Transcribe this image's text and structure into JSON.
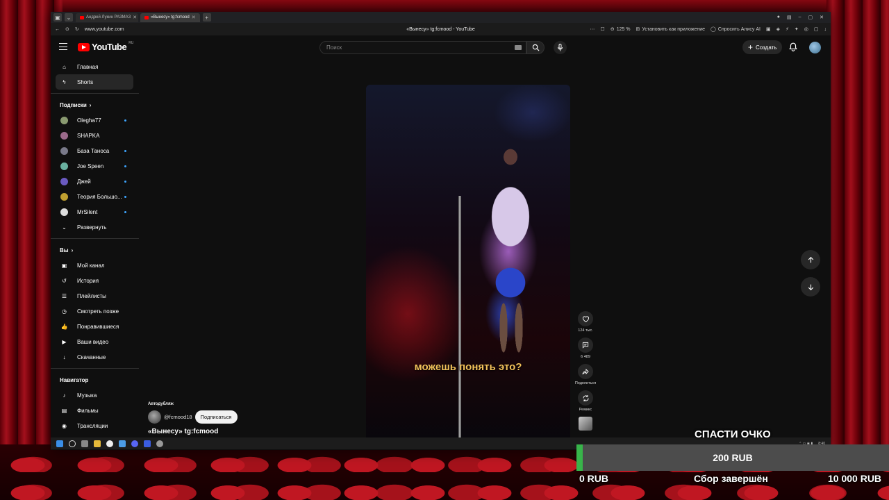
{
  "browser": {
    "tabs": [
      {
        "label": "Андрей Лукин РАЗМАЗ",
        "active": false
      },
      {
        "label": "«Вынесу» tg:fcmood",
        "active": true
      }
    ],
    "url": "www.youtube.com",
    "page_title": "«Вынесу» tg:fcmood - YouTube",
    "zoom": "125 %",
    "install_app": "Установить как приложение",
    "ask_alice": "Спросить Алису AI"
  },
  "header": {
    "logo_text": "YouTube",
    "logo_region": "RU",
    "search_placeholder": "Поиск",
    "create_label": "Создать"
  },
  "sidebar": {
    "main": [
      {
        "label": "Главная",
        "icon": "home-icon"
      },
      {
        "label": "Shorts",
        "icon": "shorts-icon",
        "active": true
      }
    ],
    "subscriptions_title": "Подписки",
    "subscriptions": [
      {
        "label": "Olegha77",
        "color": "#8a9a70",
        "dot": true
      },
      {
        "label": "SHAPKA",
        "color": "#9a6a8a",
        "dot": false
      },
      {
        "label": "База Таноса",
        "color": "#7a7a8a",
        "dot": true
      },
      {
        "label": "Joe Speen",
        "color": "#6ab0a0",
        "dot": true
      },
      {
        "label": "Джей",
        "color": "#6a5ac0",
        "dot": true
      },
      {
        "label": "Теория Большо...",
        "color": "#c0a030",
        "dot": true
      },
      {
        "label": "MrSilent",
        "color": "#dddddd",
        "dot": true
      }
    ],
    "expand_label": "Развернуть",
    "you_title": "Вы",
    "you_items": [
      {
        "label": "Мой канал",
        "icon": "channel-icon"
      },
      {
        "label": "История",
        "icon": "history-icon"
      },
      {
        "label": "Плейлисты",
        "icon": "playlists-icon"
      },
      {
        "label": "Смотреть позже",
        "icon": "watch-later-icon"
      },
      {
        "label": "Понравившиеся",
        "icon": "like-icon"
      },
      {
        "label": "Ваши видео",
        "icon": "your-videos-icon"
      },
      {
        "label": "Скачанные",
        "icon": "download-icon"
      }
    ],
    "navigator_title": "Навигатор",
    "navigator_items": [
      {
        "label": "Музыка",
        "icon": "music-icon"
      },
      {
        "label": "Фильмы",
        "icon": "movies-icon"
      },
      {
        "label": "Трансляции",
        "icon": "live-icon"
      }
    ]
  },
  "short": {
    "subtitle": "можешь понять это?",
    "progress": 0.66,
    "autodub_label": "Автодубляж",
    "channel": "@fcmood18",
    "subscribe_label": "Подписаться",
    "title": "«Вынесу» tg:fcmood",
    "likes": "124 тыс.",
    "comments": "6 489",
    "share_label": "Поделиться",
    "remix_label": "Ремикс"
  },
  "taskbar": {
    "time": "8:40"
  },
  "donation": {
    "title": "СПАСТИ ОЧКО",
    "current": "200 RUB",
    "min": "0 RUB",
    "max": "10 000 RUB",
    "status": "Сбор завершён",
    "progress": 0.02,
    "fill_color": "#38b44a"
  }
}
